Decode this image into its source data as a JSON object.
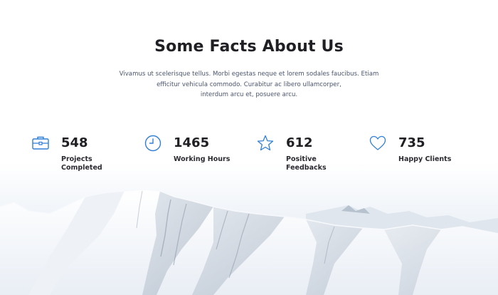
{
  "section": {
    "title": "Some Facts About Us",
    "description_lines": [
      "Vivamus ut scelerisque tellus. Morbi egestas neque et lorem sodales faucibus. Etiam",
      "efficitur vehicula commodo. Curabitur ac libero ullamcorper,",
      "interdum arcu et, posuere arcu."
    ]
  },
  "stats": [
    {
      "icon": "briefcase-icon",
      "value": "548",
      "label_lines": [
        "Projects",
        "Completed"
      ]
    },
    {
      "icon": "clock-icon",
      "value": "1465",
      "label_lines": [
        "Working Hours"
      ]
    },
    {
      "icon": "star-icon",
      "value": "612",
      "label_lines": [
        "Positive Feedbacks"
      ]
    },
    {
      "icon": "heart-icon",
      "value": "735",
      "label_lines": [
        "Happy Clients"
      ]
    }
  ],
  "colors": {
    "accent": "#2f7fd6",
    "heading": "#1f1f24",
    "text": "#4a5470"
  }
}
